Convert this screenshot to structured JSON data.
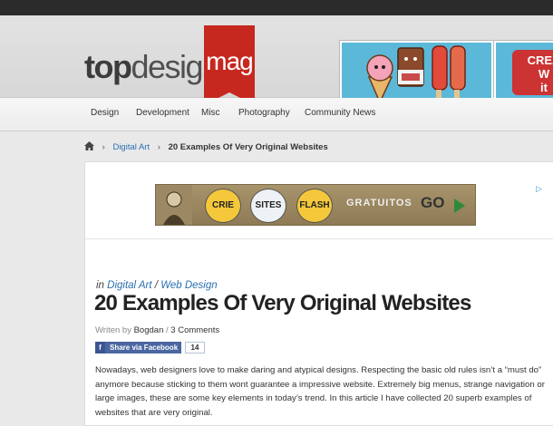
{
  "site": {
    "logo_top": "top",
    "logo_design": "design",
    "logo_mag": "mag"
  },
  "ads": {
    "top_ad_badge": "CREA\nW\nit"
  },
  "nav": {
    "items": [
      {
        "label": "Design"
      },
      {
        "label": "Development"
      },
      {
        "label": "Misc"
      },
      {
        "label": "Photography"
      },
      {
        "label": "Community News"
      }
    ]
  },
  "breadcrumb": {
    "category": "Digital Art",
    "current": "20 Examples Of Very Original Websites"
  },
  "banner": {
    "btn1": "CRIE",
    "btn2": "SITES",
    "btn3": "FLASH",
    "gratis": "GRATUITOS",
    "go": "GO"
  },
  "post": {
    "in_label": "in",
    "category_1": "Digital Art",
    "category_sep": "/",
    "category_2": "Web Design",
    "title": "20 Examples Of Very Original Websites",
    "written_by_label": "Writen by",
    "author": "Bogdan",
    "meta_sep": "/",
    "comments": "3 Comments",
    "share_label": "Share via Facebook",
    "share_count": "14",
    "intro": "Nowadays, web designers love to make daring and atypical designs. Respecting the basic old rules isn’t a “must do” anymore because sticking to them wont guarantee a impressive website. Extremely big menus, strange navigation or large images, these are some key elements in today’s trend. In this article I have collected 20 superb examples of websites that are very original."
  },
  "colors": {
    "link": "#2a6fb0",
    "ribbon": "#c6281f",
    "facebook": "#4b67a1"
  }
}
